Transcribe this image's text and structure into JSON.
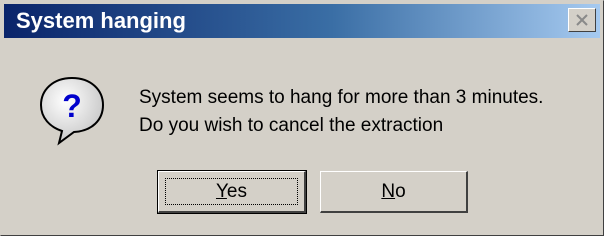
{
  "dialog": {
    "title": "System hanging",
    "message_line1": "System seems to hang for more than 3 minutes.",
    "message_line2": "Do you wish to cancel the extraction",
    "icon": "question-icon"
  },
  "buttons": {
    "yes_accel": "Y",
    "yes_rest": "es",
    "no_accel": "N",
    "no_rest": "o"
  },
  "titlebar": {
    "close_icon": "close-icon",
    "gradient_start": "#0a246a",
    "gradient_end": "#a6caf0"
  }
}
